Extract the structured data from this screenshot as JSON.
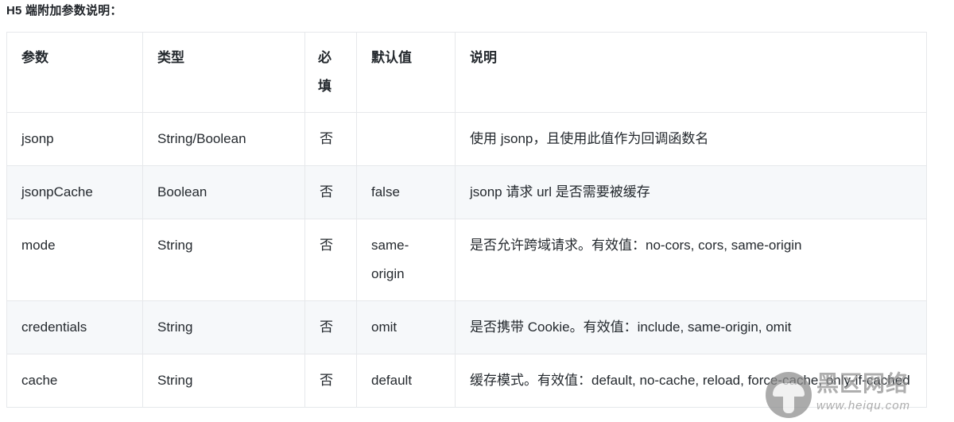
{
  "document": {
    "title": "H5 端附加参数说明："
  },
  "table": {
    "headers": [
      "参数",
      "类型",
      "必填",
      "默认值",
      "说明"
    ],
    "rows": [
      {
        "param": "jsonp",
        "type": "String/Boolean",
        "required": "否",
        "default": "",
        "description": "使用 jsonp，且使用此值作为回调函数名"
      },
      {
        "param": "jsonpCache",
        "type": "Boolean",
        "required": "否",
        "default": "false",
        "description": "jsonp 请求 url 是否需要被缓存"
      },
      {
        "param": "mode",
        "type": "String",
        "required": "否",
        "default": "same-origin",
        "description": "是否允许跨域请求。有效值：no-cors, cors, same-origin"
      },
      {
        "param": "credentials",
        "type": "String",
        "required": "否",
        "default": "omit",
        "description": "是否携带 Cookie。有效值：include, same-origin, omit"
      },
      {
        "param": "cache",
        "type": "String",
        "required": "否",
        "default": "default",
        "description": "缓存模式。有效值：default, no-cache, reload, force-cache, only-if-cached"
      }
    ]
  },
  "watermark": {
    "logo_icon": "mushroom-icon",
    "brand": "黑区网络",
    "url": "www.heiqu.com"
  },
  "colors": {
    "text": "#24292e",
    "border": "#e6e8eb",
    "stripe": "#f6f8fa",
    "watermark": "#8f8f8f"
  }
}
